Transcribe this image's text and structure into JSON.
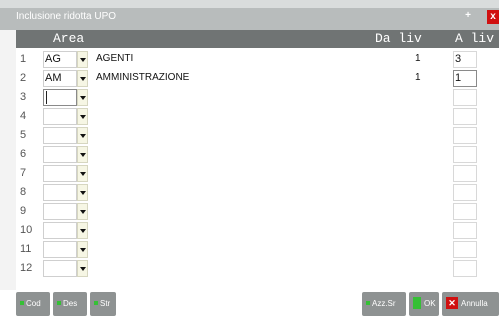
{
  "window": {
    "title": "Inclusione ridotta UPO",
    "maximize_icon": "+",
    "close_icon": "x"
  },
  "header": {
    "area": "Area",
    "da_liv": "Da liv",
    "a_liv": "A liv"
  },
  "rows": [
    {
      "num": "1",
      "code": "AG",
      "desc": "AGENTI",
      "da": "1",
      "a": "3"
    },
    {
      "num": "2",
      "code": "AM",
      "desc": "AMMINISTRAZIONE",
      "da": "1",
      "a": "1"
    },
    {
      "num": "3",
      "code": "",
      "desc": "",
      "da": "",
      "a": ""
    },
    {
      "num": "4",
      "code": "",
      "desc": "",
      "da": "",
      "a": ""
    },
    {
      "num": "5",
      "code": "",
      "desc": "",
      "da": "",
      "a": ""
    },
    {
      "num": "6",
      "code": "",
      "desc": "",
      "da": "",
      "a": ""
    },
    {
      "num": "7",
      "code": "",
      "desc": "",
      "da": "",
      "a": ""
    },
    {
      "num": "8",
      "code": "",
      "desc": "",
      "da": "",
      "a": ""
    },
    {
      "num": "9",
      "code": "",
      "desc": "",
      "da": "",
      "a": ""
    },
    {
      "num": "10",
      "code": "",
      "desc": "",
      "da": "",
      "a": ""
    },
    {
      "num": "11",
      "code": "",
      "desc": "",
      "da": "",
      "a": ""
    },
    {
      "num": "12",
      "code": "",
      "desc": "",
      "da": "",
      "a": ""
    }
  ],
  "footer": {
    "cod": "Cod",
    "des": "Des",
    "str": "Str",
    "azz": "Azz.Sr",
    "ok": "OK",
    "annulla": "Annulla"
  },
  "colors": {
    "titlebar": "#b8bcbc",
    "header": "#707474",
    "button": "#8e9292",
    "green": "#35c035",
    "red": "#d01010"
  }
}
